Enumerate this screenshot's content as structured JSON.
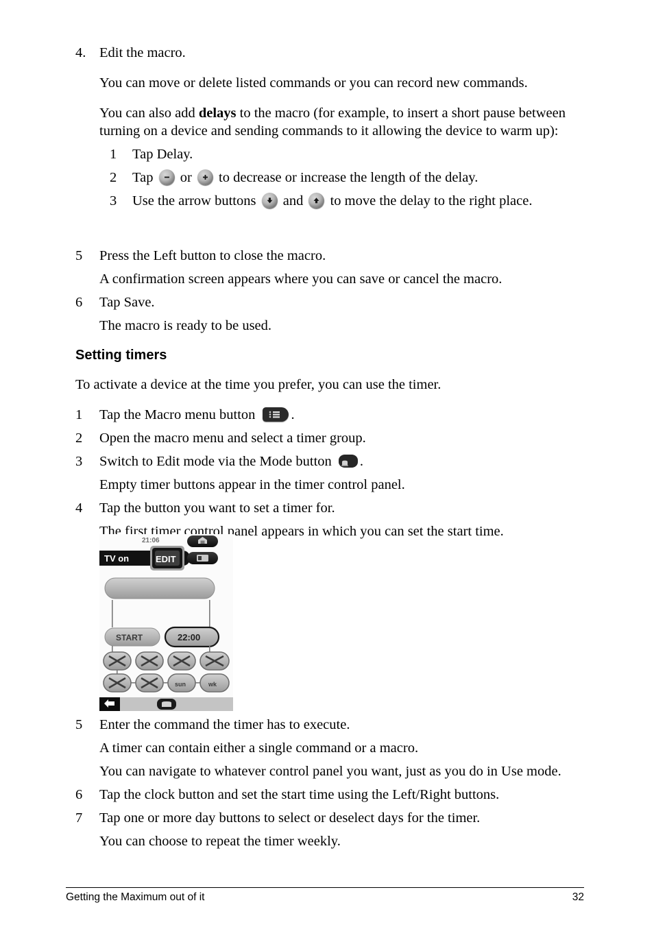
{
  "page": {
    "number": "32",
    "footer_title": "Getting the Maximum out of it"
  },
  "section_macro": {
    "step4": {
      "number": "4.",
      "text": "Edit the macro.",
      "para1": "You can move or delete listed commands or you can record new commands.",
      "para2_before": "You can also add ",
      "para2_bold": "delays",
      "para2_after": " to the macro (for example, to insert a short pause between turning on a device and sending commands to it allowing the device to warm up):",
      "substeps": [
        {
          "number": "1",
          "text_before": "Tap Delay.",
          "text_mid": "",
          "text_after": ""
        },
        {
          "number": "2",
          "text_before": "Tap ",
          "text_mid": " or ",
          "text_after": " to decrease or increase the length of the delay."
        },
        {
          "number": "3",
          "text_before": "Use the arrow buttons ",
          "text_mid": " and ",
          "text_after": " to move the delay to the right place."
        }
      ]
    },
    "step5": {
      "number": "5",
      "text": "Press the Left button to close the macro.",
      "para": "A confirmation screen appears where you can save or cancel the macro."
    },
    "step6": {
      "number": "6",
      "text": "Tap Save.",
      "para": "The macro is ready to be used."
    }
  },
  "section_timers": {
    "heading": "Setting timers",
    "intro": "To activate a device at the time you prefer, you can use the timer.",
    "step1": {
      "number": "1",
      "text_before": "Tap the Macro menu button ",
      "text_after": "."
    },
    "step2": {
      "number": "2",
      "text": "Open the macro menu and select a timer group."
    },
    "step3": {
      "number": "3",
      "text_before": "Switch to Edit mode via the Mode button ",
      "text_after": ".",
      "para": "Empty timer buttons appear in the timer control panel."
    },
    "step4": {
      "number": "4",
      "text": "Tap the button you want to set a timer for.",
      "para": "The first timer control panel appears in which you can set the start time."
    },
    "step5": {
      "number": "5",
      "text": "Enter the command the timer has to execute.",
      "para1": "A timer can contain either a single command or a macro.",
      "para2": "You can navigate to whatever control panel you want, just as you do in Use mode."
    },
    "step6": {
      "number": "6",
      "text": "Tap the clock button and set the start time using the Left/Right buttons."
    },
    "step7": {
      "number": "7",
      "text": "Tap one or more day buttons to select or deselect days for the timer.",
      "para": "You can choose to repeat the timer weekly."
    }
  },
  "device_screenshot": {
    "clock": "21:06",
    "label_bar": "TV on",
    "edit_button": "EDIT",
    "start_button": "START",
    "time_button": "22:00",
    "day_buttons": [
      {
        "label": "",
        "state": "empty"
      },
      {
        "label": "",
        "state": "empty"
      },
      {
        "label": "",
        "state": "empty"
      },
      {
        "label": "",
        "state": "empty"
      },
      {
        "label": "",
        "state": "empty"
      },
      {
        "label": "",
        "state": "empty"
      },
      {
        "label": "sun",
        "state": "labeled"
      },
      {
        "label": "wk",
        "state": "labeled"
      }
    ],
    "icons": {
      "home": "home-icon",
      "page": "page-icon",
      "back": "back-arrow-icon",
      "mode": "mode-icon"
    }
  },
  "colors": {
    "text": "#000000",
    "page_bg": "#ffffff",
    "lcd_bg": "#fbfbfb",
    "lcd_button": "#b4b4b4",
    "lcd_dark": "#1c1c1c",
    "lcd_panel": "#c9c9c9"
  }
}
